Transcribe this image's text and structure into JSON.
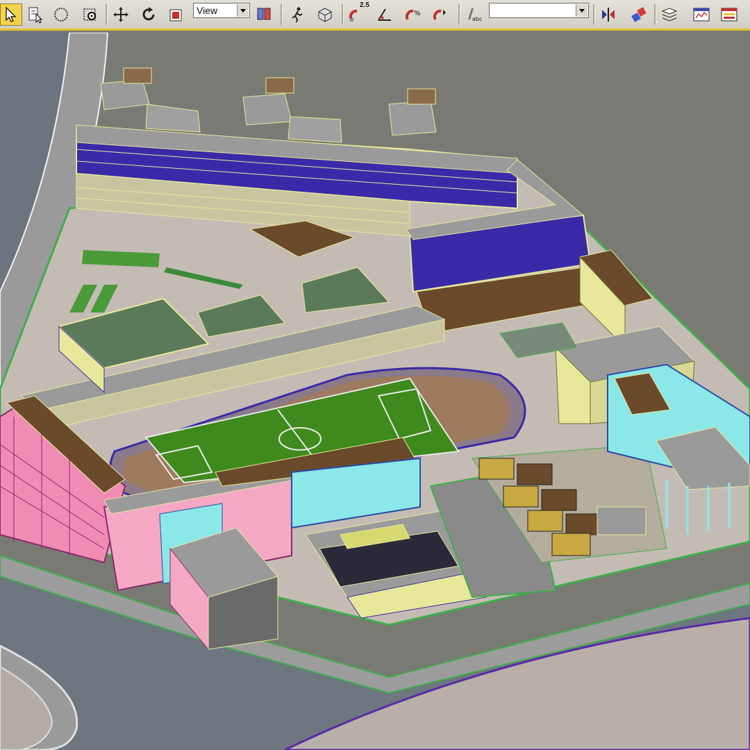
{
  "toolbar": {
    "view_dropdown_label": "View",
    "selection_set_value": "",
    "snap_label": "2.5",
    "active_tool": "select-tool",
    "accent_color": "#f3d34a",
    "icons": [
      "select-arrow-icon",
      "select-by-name-icon",
      "circle-select-region-icon",
      "select-and-link-icon",
      "move-icon",
      "rotate-icon",
      "scale-icon",
      "reference-coordinate-dropdown",
      "use-pivot-center-icon",
      "select-and-manipulate-icon",
      "keyboard-shortcut-icon",
      "snaps-toggle-icon",
      "angle-snap-icon",
      "percent-snap-icon",
      "spinner-snap-icon",
      "edit-named-selection-icon",
      "named-selection-dropdown",
      "mirror-icon",
      "align-icon",
      "layer-manager-icon",
      "curve-editor-icon",
      "schematic-view-icon"
    ]
  },
  "viewport": {
    "name": "perspective-viewport",
    "background_color": "#7a7a74",
    "colors": {
      "road": "#6e7680",
      "sidewalk": "#9a9a9a",
      "plaza": "#c4bcb4",
      "grass": "#3e8a1c",
      "track": "#9e7a5e",
      "roof_gray": "#9a9a9a",
      "roof_brown": "#6a4a2a",
      "facade_blue": "#3a2aa8",
      "facade_pink": "#f08cb4",
      "facade_cyan": "#8ce8e8",
      "facade_yellow": "#e8e89a",
      "gym_green": "#5a7a5a"
    }
  }
}
